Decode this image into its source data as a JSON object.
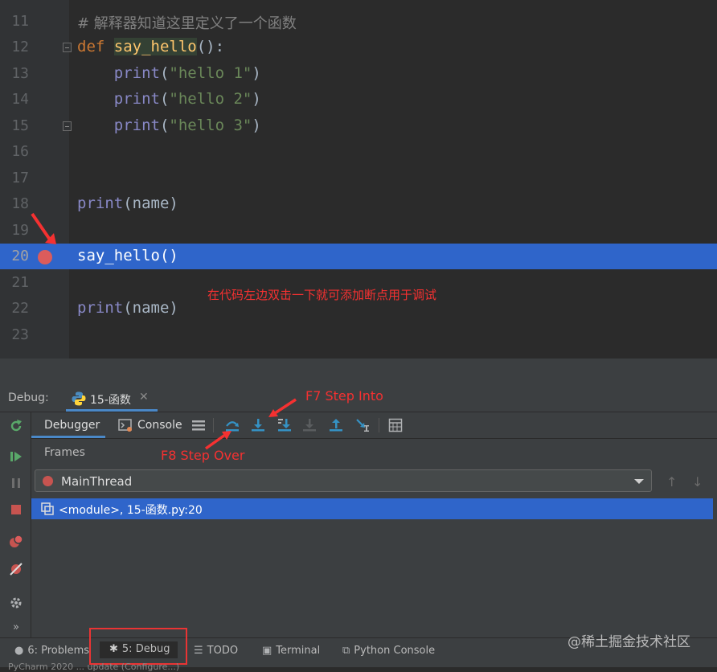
{
  "editor": {
    "lines": [
      {
        "num": "11",
        "comment": "# 解释器知道这里定义了一个函数"
      },
      {
        "num": "12",
        "def_kw": "def",
        "fn_name": "say_hello",
        "tail": "():"
      },
      {
        "num": "13",
        "indent": "    ",
        "call": "print",
        "open": "(",
        "str": "\"hello 1\"",
        "close": ")"
      },
      {
        "num": "14",
        "indent": "    ",
        "call": "print",
        "open": "(",
        "str": "\"hello 2\"",
        "close": ")"
      },
      {
        "num": "15",
        "indent": "    ",
        "call": "print",
        "open": "(",
        "str": "\"hello 3\"",
        "close": ")"
      },
      {
        "num": "16"
      },
      {
        "num": "17"
      },
      {
        "num": "18",
        "call": "print",
        "args": "(name)"
      },
      {
        "num": "19"
      },
      {
        "num": "20",
        "plain": "say_hello()"
      },
      {
        "num": "21"
      },
      {
        "num": "22",
        "call": "print",
        "args": "(name)"
      },
      {
        "num": "23"
      }
    ],
    "annotation": "在代码左边双击一下就可添加断点用于调试"
  },
  "debug": {
    "label": "Debug:",
    "session_tab": "15-函数",
    "tabs": {
      "debugger": "Debugger",
      "console": "Console"
    },
    "step_into_label": "F7 Step Into",
    "step_over_label": "F8 Step Over",
    "frames_label": "Frames",
    "thread": "MainThread",
    "frame": "<module>, 15-函数.py:20"
  },
  "bottom_bar": {
    "problems": "6: Problems",
    "debug": "5: Debug",
    "todo": "TODO",
    "terminal": "Terminal",
    "python_console": "Python Console",
    "status_fragment": "PyCharm 2020 ... update (Configure...)"
  },
  "watermark": "@稀土掘金技术社区",
  "colors": {
    "accent": "#2f65ca",
    "breakpoint": "#db5c5c",
    "annotation": "#f53131"
  }
}
